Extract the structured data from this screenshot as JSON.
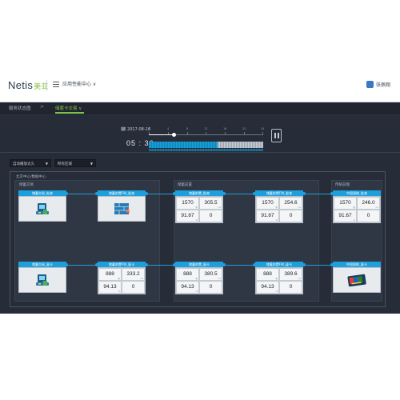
{
  "topbar": {
    "logo_main": "Netis",
    "logo_cn": "美亚",
    "app_menu": "应用性能中心 ∨",
    "user": "张佩翔"
  },
  "breadcrumb": {
    "item1": "服务状态图",
    "sep": ">",
    "item2": "储蓄卡交易 ∨"
  },
  "timeline": {
    "date": "2017-08-18",
    "time": "05 : 36",
    "ticks": [
      "0",
      "4",
      "8",
      "12",
      "16",
      "20",
      "24"
    ],
    "progress": 0.6
  },
  "filters": {
    "select1": "自动播放太久",
    "select2": "所有区域"
  },
  "panel": {
    "title": "北京中心/数据中心",
    "columns": [
      "储蓄交易",
      "储蓄前置",
      "传统前端"
    ]
  },
  "nodes": {
    "n1": {
      "title": "储蓄交易_批来"
    },
    "n2": {
      "title": "储蓄前置FW_批来"
    },
    "n3": {
      "title": "储蓄前置_批来",
      "v1": "1570",
      "v2": "305.5",
      "v3": "91.67",
      "v4": "0"
    },
    "n4": {
      "title": "储蓄前置FW_批来",
      "v1": "1570",
      "v2": "254.6",
      "v3": "91.67",
      "v4": "0"
    },
    "n5": {
      "title": "中国银联_批来",
      "v1": "1570",
      "v2": "246.0",
      "v3": "91.67",
      "v4": "0"
    },
    "n6": {
      "title": "储蓄交易_厦卡"
    },
    "n7": {
      "title": "储蓄前置FW_厦卡",
      "v1": "888",
      "v2": "333.2",
      "v3": "94.13",
      "v4": "0"
    },
    "n8": {
      "title": "储蓄前置_厦卡",
      "v1": "888",
      "v2": "380.5",
      "v3": "94.13",
      "v4": "0"
    },
    "n9": {
      "title": "储蓄前置FW_厦卡",
      "v1": "888",
      "v2": "389.6",
      "v3": "94.13",
      "v4": "0"
    },
    "n10": {
      "title": "中国银联_厦卡"
    }
  },
  "units": {
    "count": "笔",
    "ms": "ms",
    "pct": "%"
  },
  "icons": {
    "n1": "terminal-icon",
    "n2": "firewall-icon",
    "n6": "terminal-icon",
    "n10": "unionpay-card-icon"
  },
  "colors": {
    "accent": "#1d9fdc",
    "brand_green": "#7fc24a",
    "background": "#262c38"
  }
}
